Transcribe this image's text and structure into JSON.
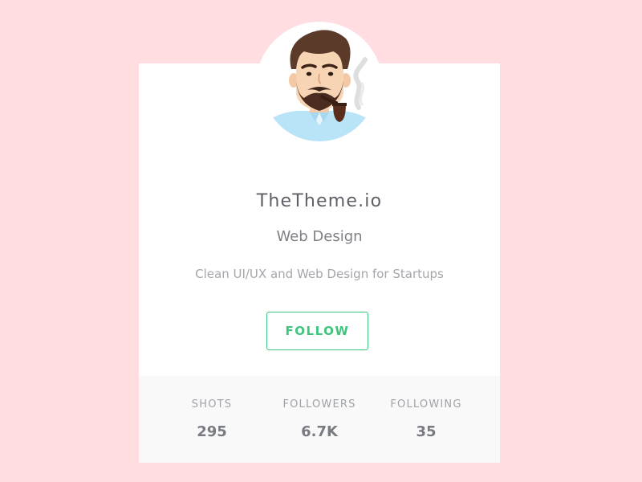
{
  "profile": {
    "name": "TheTheme.io",
    "role": "Web Design",
    "tagline": "Clean UI/UX and Web Design for Startups",
    "follow_label": "FOLLOW"
  },
  "stats": {
    "shots": {
      "label": "SHOTS",
      "value": "295"
    },
    "followers": {
      "label": "FOLLOWERS",
      "value": "6.7K"
    },
    "following": {
      "label": "FOLLOWING",
      "value": "35"
    }
  },
  "colors": {
    "page_background": "#ffdde1",
    "card_background": "#ffffff",
    "stats_background": "#f9f9f9",
    "accent": "#3ec47c",
    "name_text": "#5d6066",
    "muted_text": "#a4a6ab"
  },
  "icons": {
    "avatar": "man-with-pipe-illustration"
  }
}
